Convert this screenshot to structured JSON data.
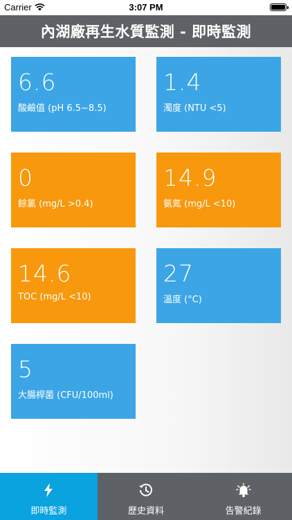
{
  "status_bar": {
    "carrier": "Carrier",
    "time": "3:07 PM"
  },
  "header": {
    "title": "內湖廠再生水質監測 - 即時監測"
  },
  "tiles": [
    {
      "value": "6.6",
      "label": "酸鹼值 (pH 6.5~8.5)",
      "color": "#3ba5e6"
    },
    {
      "value": "1.4",
      "label": "濁度 (NTU <5)",
      "color": "#3ba5e6"
    },
    {
      "value": "0",
      "label": "餘氯 (mg/L >0.4)",
      "color": "#f7980d"
    },
    {
      "value": "14.9",
      "label": "氨氮 (mg/L <10)",
      "color": "#f7980d"
    },
    {
      "value": "14.6",
      "label": "TOC (mg/L <10)",
      "color": "#f7980d"
    },
    {
      "value": "27",
      "label": "溫度 (°C)",
      "color": "#3ba5e6"
    },
    {
      "value": "5",
      "label": "大腸桿菌 (CFU/100ml)",
      "color": "#3ba5e6"
    }
  ],
  "tabbar": {
    "tabs": [
      {
        "label": "即時監測",
        "icon": "lightning-icon",
        "active": true
      },
      {
        "label": "歷史資料",
        "icon": "history-icon",
        "active": false
      },
      {
        "label": "告警紀錄",
        "icon": "alarm-bell-icon",
        "active": false
      }
    ]
  },
  "colors": {
    "header": "#5e6266",
    "tab_active": "#0aa2df",
    "blue": "#3ba5e6",
    "orange": "#f7980d"
  }
}
